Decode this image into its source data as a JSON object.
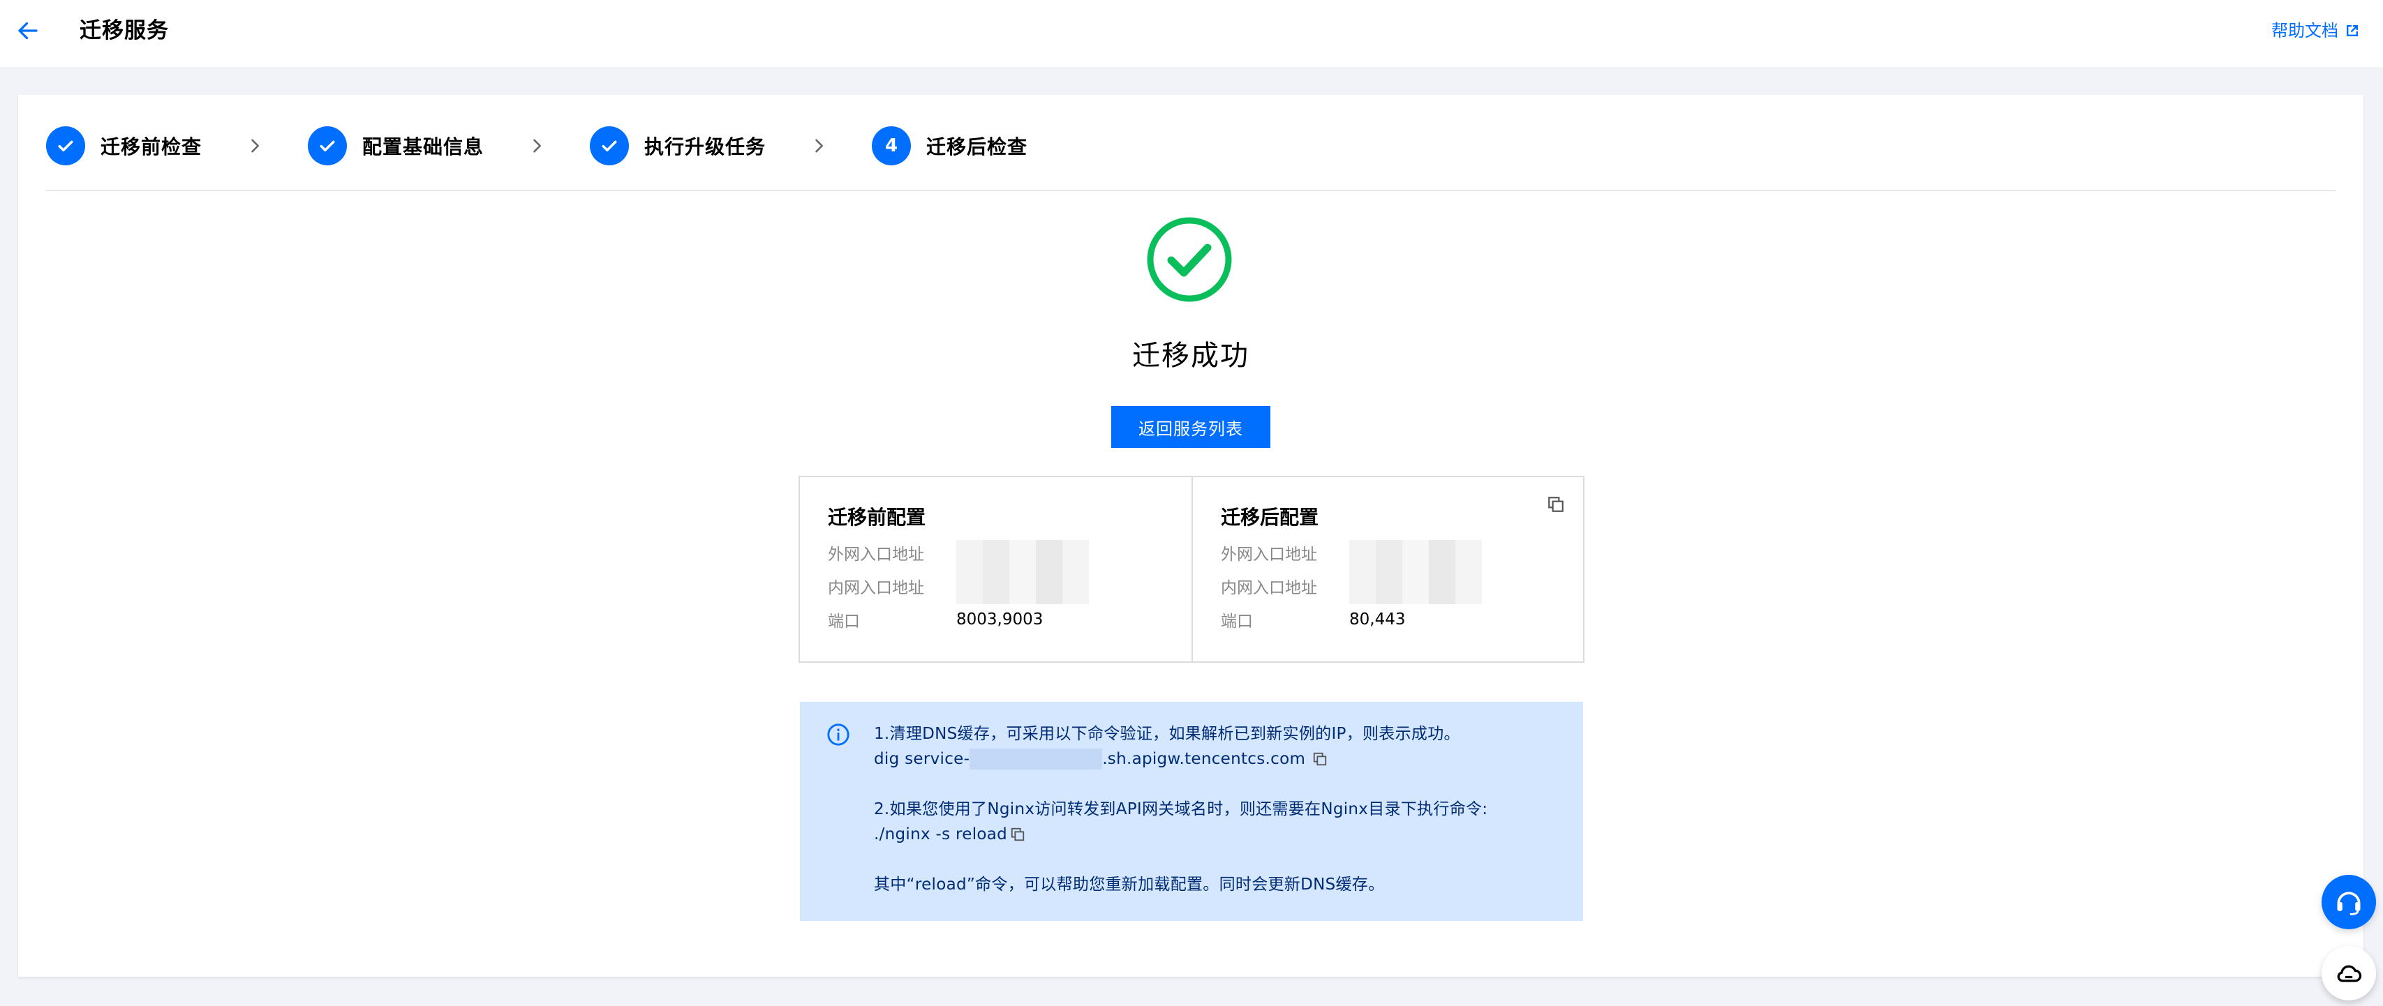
{
  "header": {
    "title": "迁移服务",
    "help_label": "帮助文档"
  },
  "steps": [
    {
      "label": "迁移前检查",
      "state": "done"
    },
    {
      "label": "配置基础信息",
      "state": "done"
    },
    {
      "label": "执行升级任务",
      "state": "done"
    },
    {
      "label": "迁移后检查",
      "state": "active",
      "number": "4"
    }
  ],
  "result": {
    "title": "迁移成功",
    "button_label": "返回服务列表"
  },
  "before_config": {
    "title": "迁移前配置",
    "public_label": "外网入口地址",
    "private_label": "内网入口地址",
    "port_label": "端口",
    "port_value": "8003,9003"
  },
  "after_config": {
    "title": "迁移后配置",
    "public_label": "外网入口地址",
    "private_label": "内网入口地址",
    "port_label": "端口",
    "port_value": "80,443"
  },
  "info": {
    "line1": "1.清理DNS缓存，可采用以下命令验证，如果解析已到新实例的IP，则表示成功。",
    "cmd1_prefix": "dig service-",
    "cmd1_suffix": ".sh.apigw.tencentcs.com",
    "line2": "2.如果您使用了Nginx访问转发到API网关域名时，则还需要在Nginx目录下执行命令:",
    "cmd2": "./nginx -s reload",
    "line3": "其中“reload”命令，可以帮助您重新加载配置。同时会更新DNS缓存。"
  },
  "colors": {
    "primary": "#006eff",
    "success": "#0abf5b",
    "info_bg": "#d5e7ff",
    "info_text": "#002b75"
  }
}
